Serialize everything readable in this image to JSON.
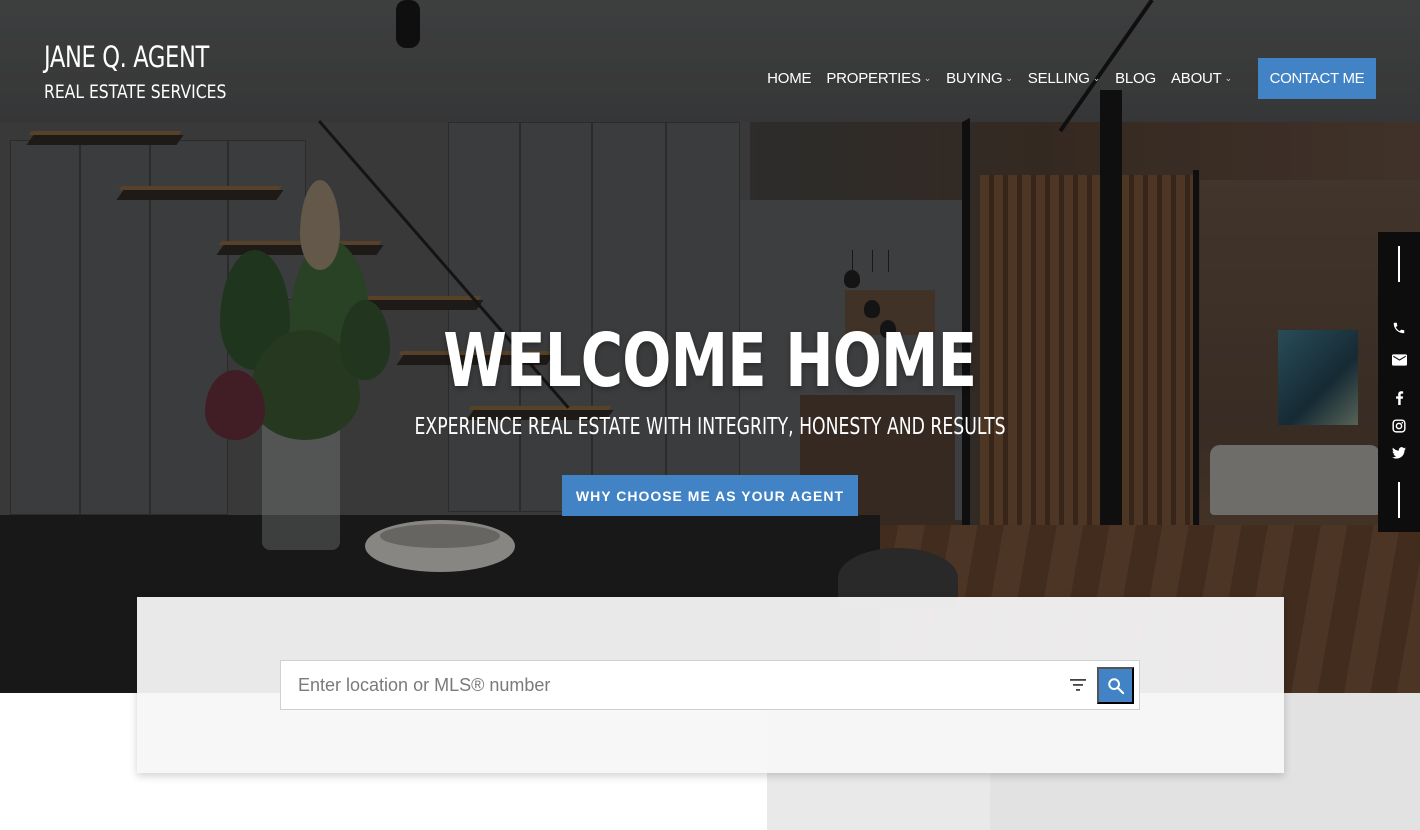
{
  "brand": {
    "name": "JANE Q. AGENT",
    "tagline": "REAL ESTATE SERVICES"
  },
  "nav": {
    "items": [
      {
        "label": "HOME",
        "has_dropdown": false
      },
      {
        "label": "PROPERTIES",
        "has_dropdown": true
      },
      {
        "label": "BUYING",
        "has_dropdown": true
      },
      {
        "label": "SELLING",
        "has_dropdown": true
      },
      {
        "label": "BLOG",
        "has_dropdown": false
      },
      {
        "label": "ABOUT",
        "has_dropdown": true
      }
    ],
    "contact_label": "CONTACT ME"
  },
  "hero": {
    "title": "WELCOME HOME",
    "subtitle": "EXPERIENCE REAL ESTATE WITH INTEGRITY, HONESTY AND RESULTS",
    "cta_label": "WHY CHOOSE ME AS YOUR AGENT"
  },
  "social": {
    "icons": [
      "phone-icon",
      "email-icon",
      "facebook-icon",
      "instagram-icon",
      "twitter-icon"
    ]
  },
  "search": {
    "placeholder": "Enter location or MLS® number",
    "value": ""
  },
  "colors": {
    "accent": "#4183c4",
    "social_bar": "#0d0d0d",
    "panel": "#f7f7f8"
  }
}
